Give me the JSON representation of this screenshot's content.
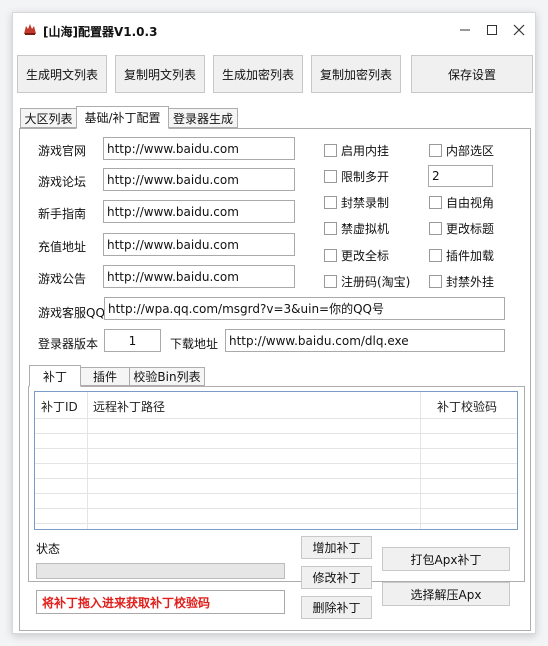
{
  "window": {
    "title": "[山海]配置器V1.0.3"
  },
  "toolbar": {
    "btn1": "生成明文列表",
    "btn2": "复制明文列表",
    "btn3": "生成加密列表",
    "btn4": "复制加密列表",
    "btn5": "保存设置"
  },
  "main_tabs": [
    "大区列表",
    "基础/补丁配置",
    "登录器生成"
  ],
  "form": {
    "official_site_label": "游戏官网",
    "official_site": "http://www.baidu.com",
    "forum_label": "游戏论坛",
    "forum": "http://www.baidu.com",
    "guide_label": "新手指南",
    "guide": "http://www.baidu.com",
    "recharge_label": "充值地址",
    "recharge": "http://www.baidu.com",
    "notice_label": "游戏公告",
    "notice": "http://www.baidu.com",
    "qq_label": "游戏客服QQ",
    "qq": "http://wpa.qq.com/msgrd?v=3&uin=你的QQ号",
    "version_label": "登录器版本",
    "version": "1",
    "download_label": "下载地址",
    "download": "http://www.baidu.com/dlq.exe",
    "multi_open_count": "2"
  },
  "options": {
    "enable_cover": "启用内挂",
    "internal_zone": "内部选区",
    "limit_multi": "限制多开",
    "block_record": "封禁录制",
    "free_view": "自由视角",
    "block_vm": "禁虚拟机",
    "change_title": "更改标题",
    "change_all": "更改全标",
    "plugin_load": "插件加载",
    "reg_code": "注册码(淘宝)",
    "block_cheat": "封禁外挂"
  },
  "sub_tabs": [
    "补丁",
    "插件",
    "校验Bin列表"
  ],
  "patch_table": {
    "columns": [
      "补丁ID",
      "远程补丁路径",
      "补丁校验码"
    ],
    "rows": []
  },
  "status": {
    "label": "状态",
    "hint": "将补丁拖入进来获取补丁校验码"
  },
  "patch_buttons": {
    "add": "增加补丁",
    "edit": "修改补丁",
    "remove": "删除补丁",
    "pack": "打包Apx补丁",
    "select": "选择解压Apx"
  },
  "colors": {
    "hint_red": "#e0201c",
    "table_border": "#7a9cc6"
  }
}
